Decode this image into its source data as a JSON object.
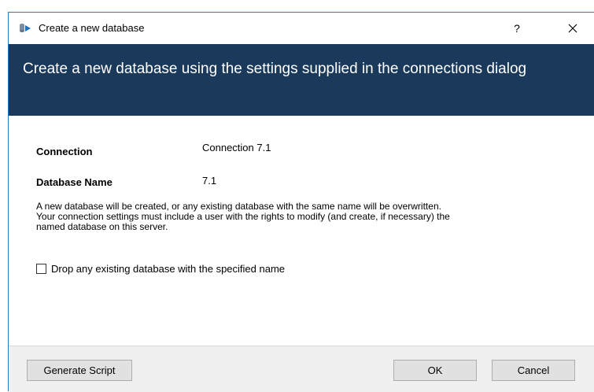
{
  "window": {
    "title": "Create a new database",
    "help_label": "?",
    "icon": "database-arrow-icon",
    "close_icon": "close-icon"
  },
  "banner": {
    "heading": "Create a new database using the settings supplied in the connections dialog"
  },
  "form": {
    "connection_label": "Connection",
    "connection_value": "Connection 7.1",
    "database_name_label": "Database Name",
    "database_name_value": "7.1"
  },
  "info": {
    "lines": [
      "A new database will be created, or any existing database with the same name will be overwritten.",
      "Your connection settings must include a user with the rights to modify (and create, if necessary) the",
      "named database on this server."
    ]
  },
  "options": {
    "drop_existing_label": "Drop any existing database with the specified name",
    "drop_existing_checked": false
  },
  "buttons": {
    "generate_script": "Generate Script",
    "ok": "OK",
    "cancel": "Cancel"
  },
  "colors": {
    "banner_bg": "#1b3a5b",
    "window_border": "#2b78c2",
    "footer_bg": "#f0f0f0"
  }
}
